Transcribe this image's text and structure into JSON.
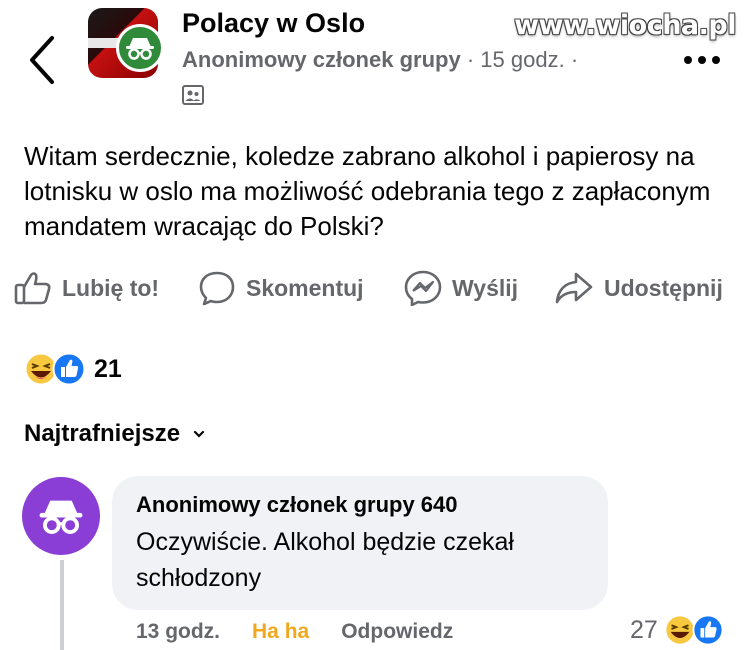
{
  "watermark": "www.wiocha.pl",
  "header": {
    "group_name": "Polacy w Oslo",
    "author": "Anonimowy członek grupy",
    "time": "15 godz.",
    "separator": "·"
  },
  "post": {
    "text": "Witam serdecznie, koledze zabrano alkohol i papierosy na lotnisku w oslo ma możliwość odebrania tego z zapłaconym mandatem wracając do Polski?"
  },
  "actions": {
    "like": "Lubię to!",
    "comment": "Skomentuj",
    "send": "Wyślij",
    "share": "Udostępnij"
  },
  "reactions": {
    "count": "21"
  },
  "comments_sort": {
    "label": "Najtrafniejsze"
  },
  "comment": {
    "author": "Anonimowy członek grupy 640",
    "text": "Oczywiście. Alkohol będzie czekał schłodzony",
    "time": "13 godz.",
    "reaction_label": "Ha ha",
    "reply": "Odpowiedz",
    "reaction_count": "27"
  },
  "colors": {
    "secondary_text": "#65676b",
    "haha": "#f0a91e",
    "like_blue": "#1877f2",
    "anon_purple": "#8a3ed6",
    "bubble": "#f0f2f5"
  },
  "icons": [
    "back-chevron-icon",
    "incognito-icon",
    "privacy-group-icon",
    "more-icon",
    "like-icon",
    "comment-icon",
    "messenger-icon",
    "share-icon",
    "haha-emoji-icon",
    "like-reaction-icon",
    "chevron-down-icon"
  ]
}
